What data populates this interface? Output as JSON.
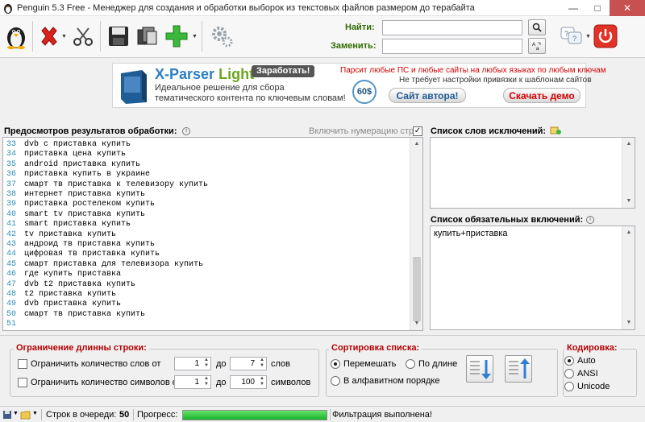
{
  "window": {
    "title": "Penguin 5.3 Free - Менеджер для создания и обработки выборок из текстовых файлов размером до терабайта"
  },
  "toolbar": {
    "find_label": "Найти:",
    "replace_label": "Заменить:",
    "find_value": "",
    "replace_value": ""
  },
  "banner": {
    "title_main": "X-Parser",
    "title_light": "Light",
    "earn": "Заработать!",
    "desc_line1": "Идеальное решение для сбора",
    "desc_line2": "тематического контента по ключевым словам!",
    "price": "60$",
    "promo_line1": "Парсит любые ПС и любые сайты на любых языках по любым ключам",
    "promo_line2": "Не требует настройки привязки к шаблонам сайтов",
    "btn_author": "Сайт автора!",
    "btn_demo": "Скачать демо"
  },
  "preview": {
    "title": "Предосмотров результатов обработки:",
    "numbering_label": "Включить нумерацию строк",
    "numbering_checked": "✓",
    "lines": [
      {
        "n": "33",
        "t": "dvb c приставка купить"
      },
      {
        "n": "34",
        "t": "приставка цена купить"
      },
      {
        "n": "35",
        "t": "android приставка купить"
      },
      {
        "n": "36",
        "t": "приставка купить в украине"
      },
      {
        "n": "37",
        "t": "смарт тв приставка к телевизору купить"
      },
      {
        "n": "38",
        "t": "интернет приставка купить"
      },
      {
        "n": "39",
        "t": "приставка ростелеком купить"
      },
      {
        "n": "40",
        "t": "smart tv приставка купить"
      },
      {
        "n": "41",
        "t": "smart приставка купить"
      },
      {
        "n": "42",
        "t": "tv приставка купить"
      },
      {
        "n": "43",
        "t": "андроид тв приставка купить"
      },
      {
        "n": "44",
        "t": "цифровая тв приставка купить"
      },
      {
        "n": "45",
        "t": "смарт приставка для телевизора купить"
      },
      {
        "n": "46",
        "t": "где купить приставка"
      },
      {
        "n": "47",
        "t": "dvb t2 приставка купить"
      },
      {
        "n": "48",
        "t": "t2 приставка купить"
      },
      {
        "n": "49",
        "t": "dvb приставка купить"
      },
      {
        "n": "50",
        "t": "смарт тв приставка купить"
      },
      {
        "n": "51",
        "t": ""
      }
    ]
  },
  "exclusions": {
    "title": "Список слов исключений:"
  },
  "required": {
    "title": "Список обязательных включений:",
    "items": [
      "купить+приставка"
    ]
  },
  "length_limit": {
    "title": "Ограничение длинны строки:",
    "words_label": "Ограничить количество слов от",
    "words_from": "1",
    "words_to": "7",
    "words_unit": "слов",
    "chars_label": "Ограничить количество символов от",
    "chars_from": "1",
    "chars_to": "100",
    "chars_unit": "символов",
    "to_label": "до"
  },
  "sorting": {
    "title": "Сортировка списка:",
    "shuffle": "Перемешать",
    "by_length": "По длине",
    "alphabetical": "В алфавитном порядке"
  },
  "encoding": {
    "title": "Кодировка:",
    "auto": "Auto",
    "ansi": "ANSI",
    "unicode": "Unicode"
  },
  "status": {
    "queue_label": "Строк в очереди:",
    "queue_count": "50",
    "progress_label": "Прогресс:",
    "progress_fraction": 1.0,
    "message": "Фильтрация выполнена!"
  }
}
